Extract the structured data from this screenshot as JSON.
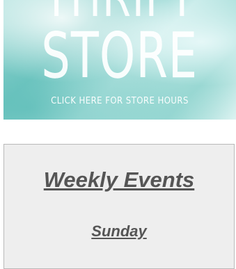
{
  "banner": {
    "title_top": "THRIFT",
    "title_main": "STORE",
    "subtitle": "CLICK HERE FOR STORE HOURS"
  },
  "events": {
    "heading": "Weekly Events",
    "day": "Sunday"
  }
}
